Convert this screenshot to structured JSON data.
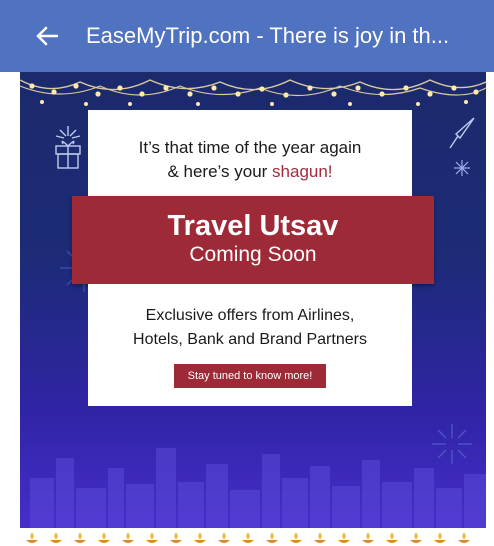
{
  "app_bar": {
    "title": "EaseMyTrip.com - There is joy in th...",
    "back_icon": "arrow-left-icon"
  },
  "banner": {
    "headline_part1": "It’s that time of the year again",
    "headline_part2": "& here’s your ",
    "headline_highlight": "shagun!",
    "ribbon_title": "Travel Utsav",
    "ribbon_subtitle": "Coming Soon",
    "offers_line1": "Exclusive offers from Airlines,",
    "offers_line2": "Hotels, Bank and Brand Partners",
    "cta_label": "Stay tuned to know more!"
  },
  "colors": {
    "app_bar": "#4f72c1",
    "banner_bg": "#1d2b78",
    "accent_maroon": "#9d2a36",
    "highlight": "#a12c3e"
  }
}
